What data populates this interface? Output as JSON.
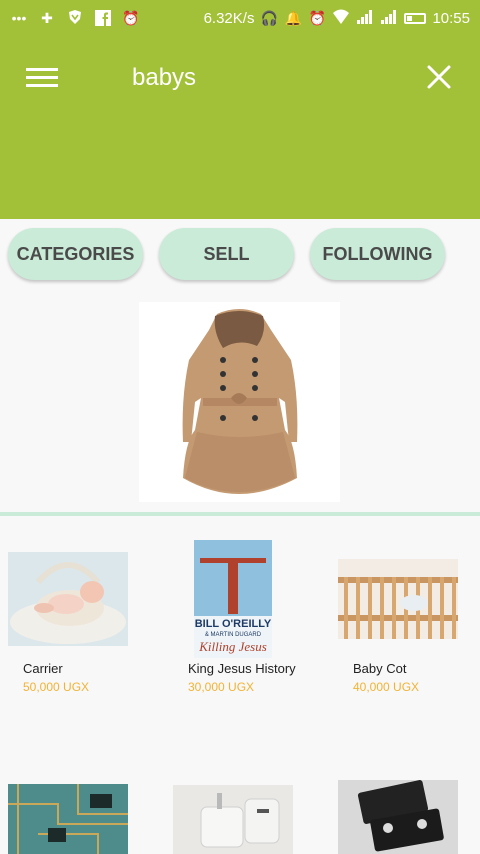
{
  "status": {
    "speed": "6.32K/s",
    "time": "10:55"
  },
  "search": {
    "query": "babys"
  },
  "tabs": [
    {
      "label": "CATEGORIES"
    },
    {
      "label": "SELL"
    },
    {
      "label": "FOLLOWING"
    }
  ],
  "products": [
    {
      "name": "Carrier",
      "price": "50,000 UGX"
    },
    {
      "name": "King Jesus History",
      "price": "30,000 UGX"
    },
    {
      "name": "Baby Cot",
      "price": "40,000 UGX"
    }
  ],
  "book": {
    "author": "BILL O'REILLY",
    "coauthor": "& MARTIN DUGARD",
    "title": "Killing Jesus"
  },
  "colors": {
    "toolbar": "#a2c139",
    "pill": "#c9ebd7",
    "price": "#f2b334"
  }
}
